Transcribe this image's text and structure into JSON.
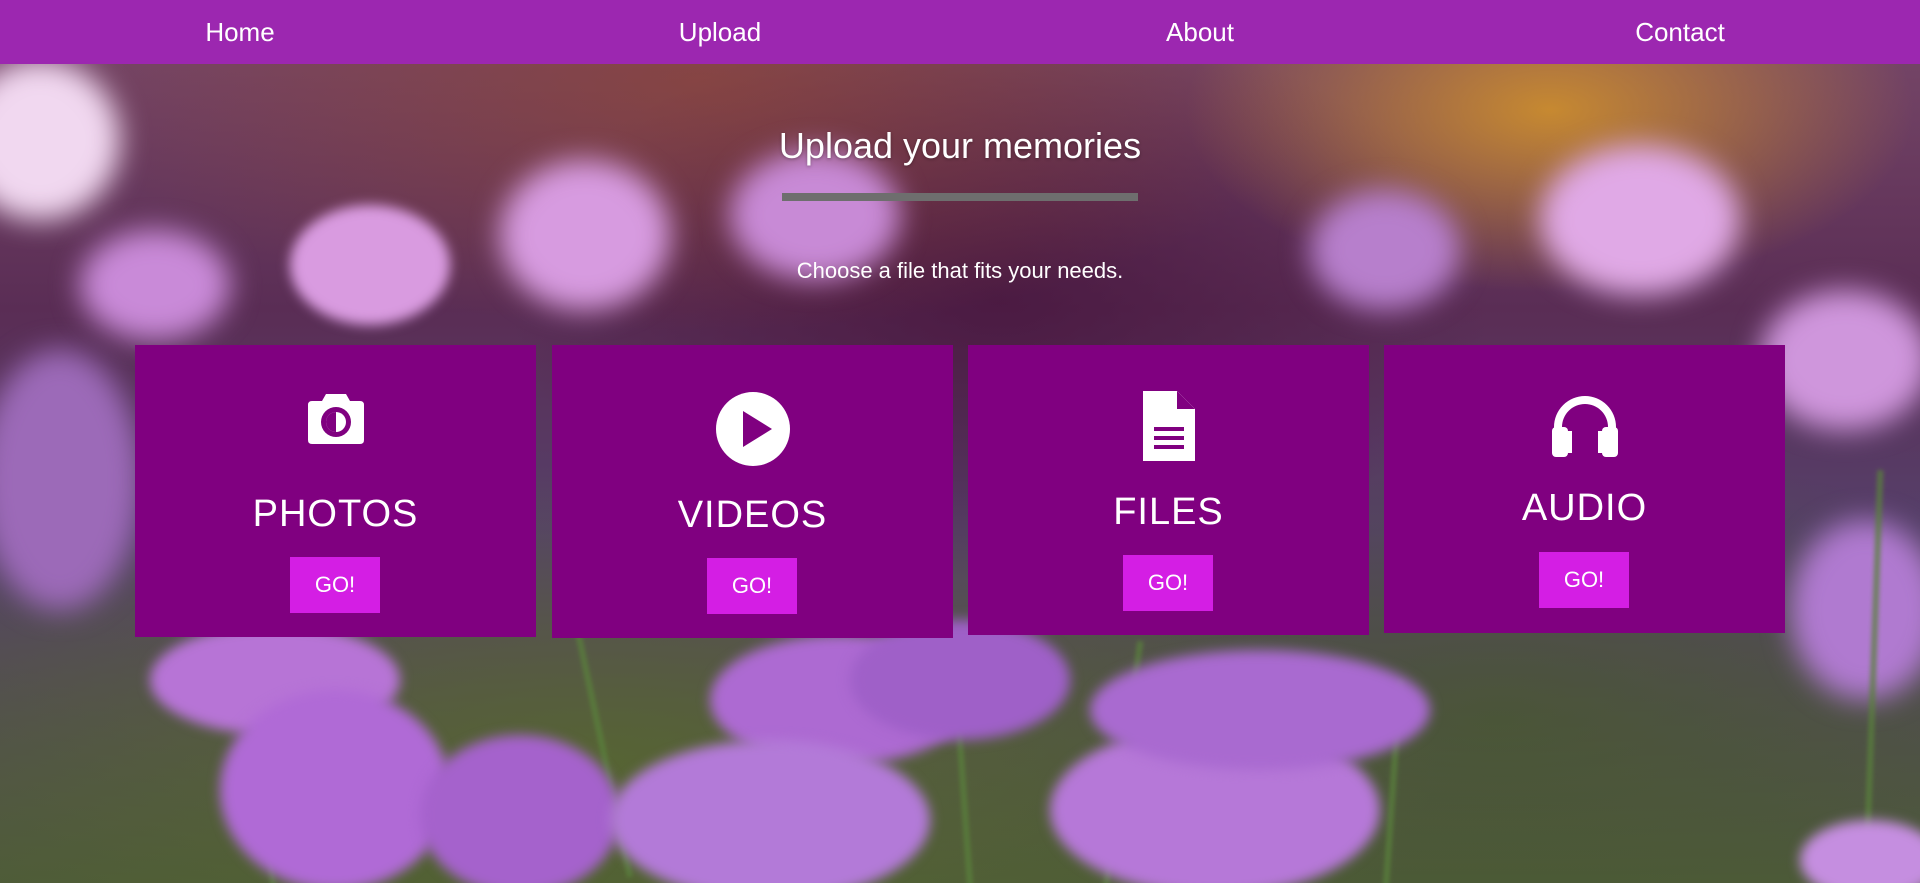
{
  "nav": {
    "items": [
      {
        "label": "Home"
      },
      {
        "label": "Upload"
      },
      {
        "label": "About"
      },
      {
        "label": "Contact"
      }
    ]
  },
  "hero": {
    "title": "Upload your memories",
    "subtitle": "Choose a file that fits your needs."
  },
  "cards": [
    {
      "title": "PHOTOS",
      "button": "GO!",
      "icon": "camera-icon"
    },
    {
      "title": "VIDEOS",
      "button": "GO!",
      "icon": "play-circle-icon"
    },
    {
      "title": "FILES",
      "button": "GO!",
      "icon": "document-icon"
    },
    {
      "title": "AUDIO",
      "button": "GO!",
      "icon": "headphones-icon"
    }
  ],
  "colors": {
    "nav_bg": "#9c27b0",
    "card_bg": "#800080",
    "button_bg": "#d41ee4",
    "rule": "#6e6e6e"
  }
}
